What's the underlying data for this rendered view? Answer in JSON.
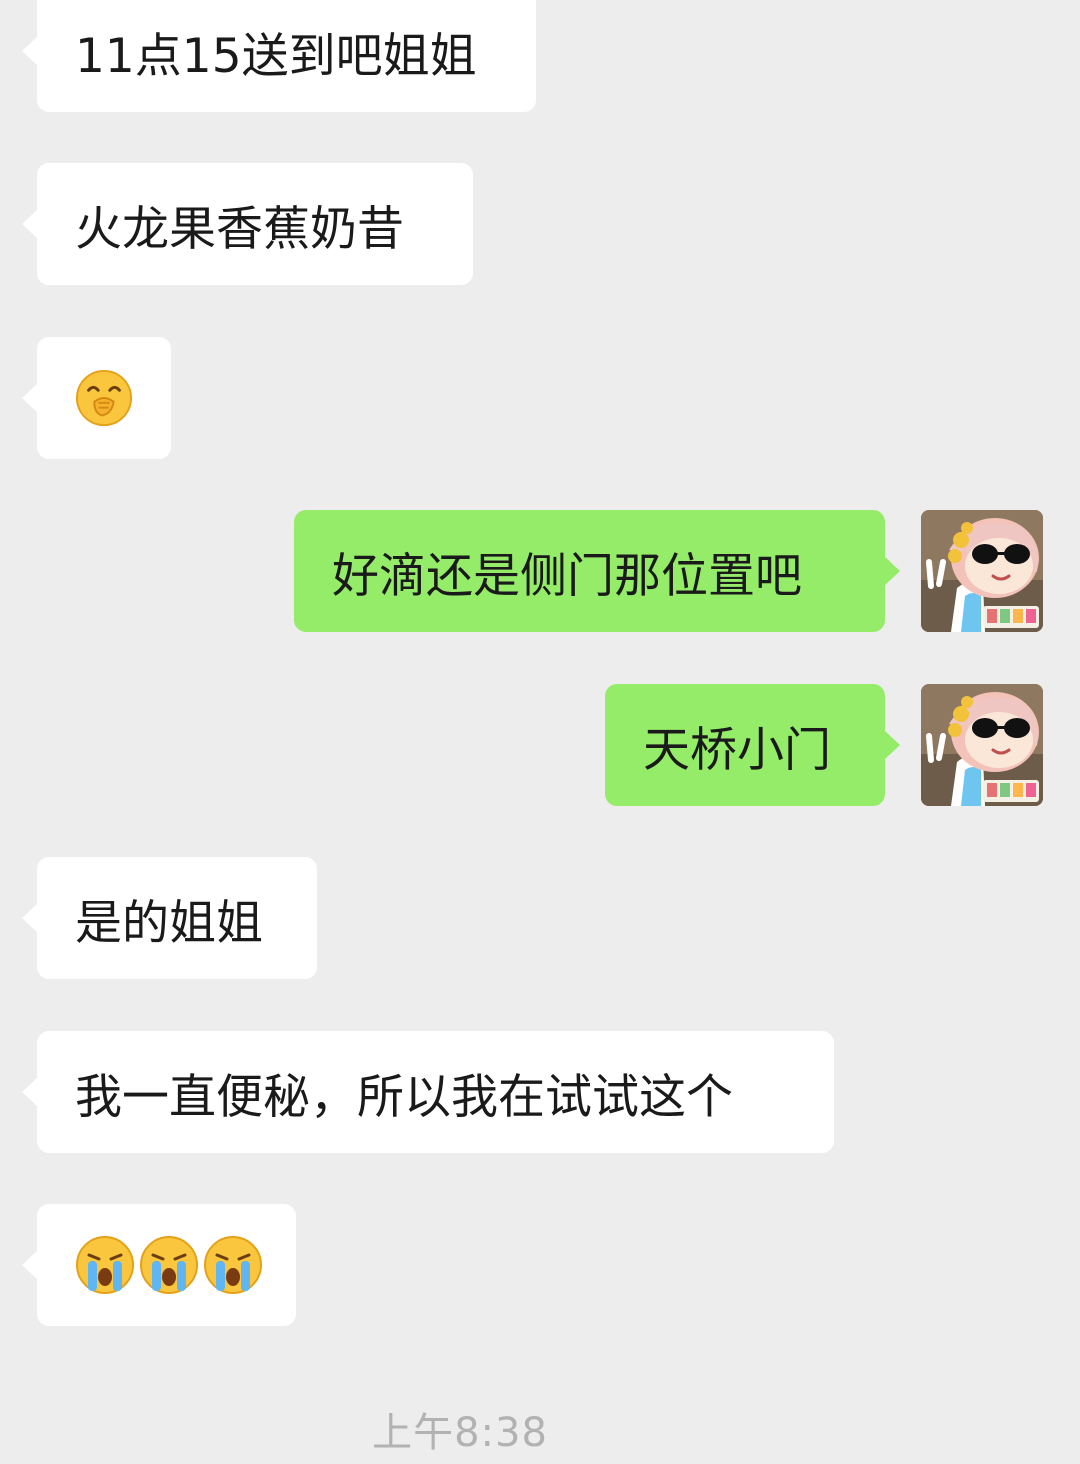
{
  "messages": [
    {
      "side": "in",
      "text": "11点15送到吧姐姐"
    },
    {
      "side": "in",
      "text": "火龙果香蕉奶昔"
    },
    {
      "side": "in",
      "emoji": [
        "covering-mouth-laugh-emoji"
      ]
    },
    {
      "side": "out",
      "text": "好滴还是侧门那位置吧"
    },
    {
      "side": "out",
      "text": "天桥小门"
    },
    {
      "side": "in",
      "text": "是的姐姐"
    },
    {
      "side": "in",
      "text": "我一直便秘，所以我在试试这个"
    },
    {
      "side": "in",
      "emoji": [
        "crying-emoji",
        "crying-emoji",
        "crying-emoji"
      ]
    }
  ],
  "timestamp": "上午8:38",
  "colors": {
    "background": "#ededed",
    "incoming_bubble": "#ffffff",
    "outgoing_bubble": "#95ec69",
    "timestamp_text": "#b2b2b2"
  }
}
